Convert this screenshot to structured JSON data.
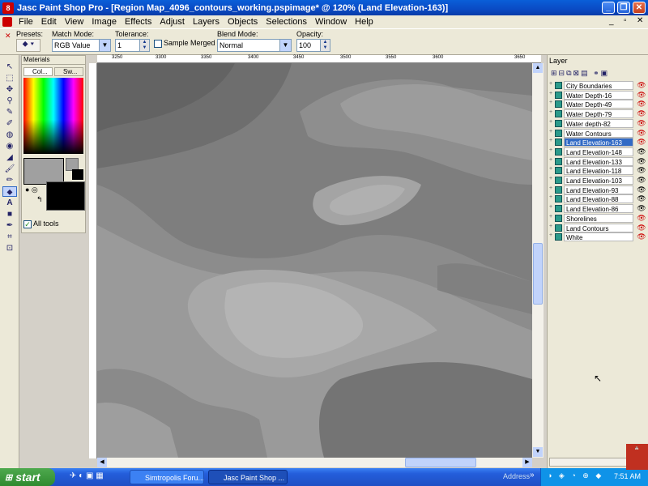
{
  "window": {
    "title": "Jasc Paint Shop Pro - [Region Map_4096_contours_working.pspimage* @ 120% (Land Elevation-163)]",
    "icon": "paint-shop-pro-icon",
    "accent": "#0a4ac4"
  },
  "menu": [
    "File",
    "Edit",
    "View",
    "Image",
    "Effects",
    "Adjust",
    "Layers",
    "Objects",
    "Selections",
    "Window",
    "Help"
  ],
  "tool_options": {
    "presets_label": "Presets:",
    "match_mode_label": "Match Mode:",
    "match_mode_value": "RGB Value",
    "tolerance_label": "Tolerance:",
    "tolerance_value": "1",
    "sample_merged_label": "Sample Merged",
    "blend_mode_label": "Blend Mode:",
    "blend_mode_value": "Normal",
    "opacity_label": "Opacity:",
    "opacity_value": "100"
  },
  "materials": {
    "title": "Materials",
    "tab1": "Col...",
    "tab2": "Sw...",
    "all_tools_label": "All tools",
    "foreground_color": "#a0a0a0",
    "background_color": "#000000"
  },
  "rulers": {
    "top_ticks": [
      "3250",
      "3300",
      "3350",
      "3400",
      "3450",
      "3500",
      "3550",
      "3600",
      "3650"
    ],
    "left_ticks": [
      "850",
      "900",
      "950",
      "1000",
      "1050",
      "1100",
      "1150",
      "1200",
      "1250"
    ]
  },
  "layers": {
    "title": "Layer",
    "items": [
      {
        "name": "City Boundaries",
        "selected": false
      },
      {
        "name": "Water Depth-16",
        "selected": false
      },
      {
        "name": "Water Depth-49",
        "selected": false
      },
      {
        "name": "Water Depth-79",
        "selected": false
      },
      {
        "name": "Water depth-82",
        "selected": false
      },
      {
        "name": "Water Contours",
        "selected": false
      },
      {
        "name": "Land Elevation-163",
        "selected": true
      },
      {
        "name": "Land Elevation-148",
        "selected": false
      },
      {
        "name": "Land Elevation-133",
        "selected": false
      },
      {
        "name": "Land Elevation-118",
        "selected": false
      },
      {
        "name": "Land Elevation-103",
        "selected": false
      },
      {
        "name": "Land Elevation-93",
        "selected": false
      },
      {
        "name": "Land Elevation-88",
        "selected": false
      },
      {
        "name": "Land Elevation-86",
        "selected": false
      },
      {
        "name": "Shorelines",
        "selected": false
      },
      {
        "name": "Land Contours",
        "selected": false
      },
      {
        "name": "White",
        "selected": false
      }
    ]
  },
  "taskbar": {
    "start_label": "start",
    "tasks": [
      "Simtropolis Foru...",
      "Jasc Paint Shop ..."
    ],
    "address_label": "Address",
    "clock": "7:51 AM"
  }
}
